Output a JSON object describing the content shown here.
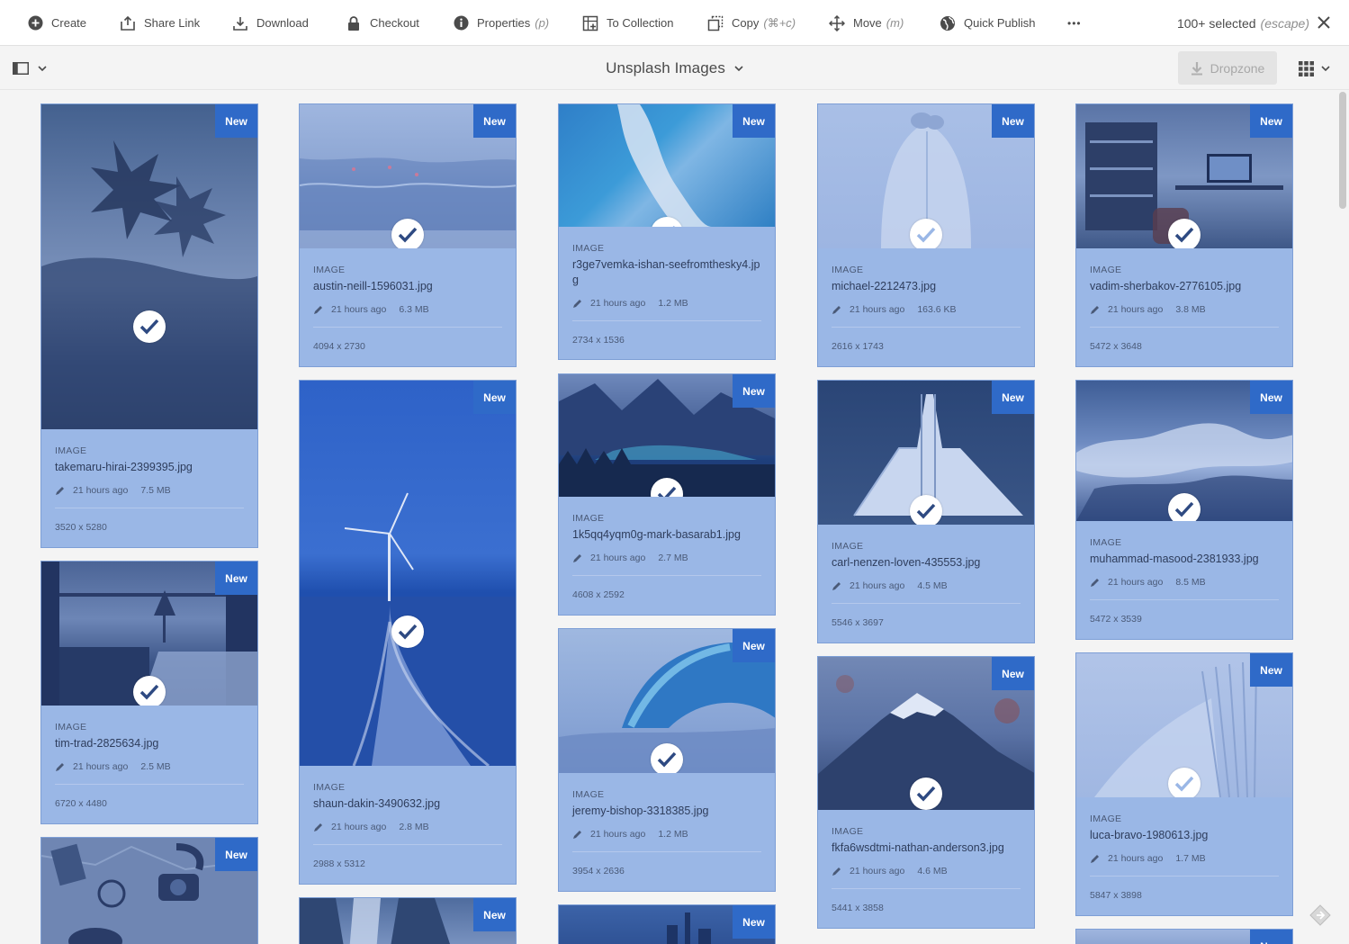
{
  "toolbar": {
    "create": "Create",
    "share_link": "Share Link",
    "download": "Download",
    "checkout": "Checkout",
    "properties": "Properties",
    "properties_hint": "(p)",
    "to_collection": "To Collection",
    "copy": "Copy",
    "copy_hint": "(⌘+c)",
    "move": "Move",
    "move_hint": "(m)",
    "quick_publish": "Quick Publish",
    "more": "•••",
    "selected": "100+ selected",
    "selected_hint": "(escape)"
  },
  "titlebar": {
    "title": "Unsplash Images",
    "dropzone": "Dropzone"
  },
  "cards": [
    {
      "badge": "New",
      "type": "IMAGE",
      "name": "takemaru-hirai-2399395.jpg",
      "time": "21 hours ago",
      "size": "7.5 MB",
      "dims": "3520 x 5280"
    },
    {
      "badge": "New",
      "type": "IMAGE",
      "name": "tim-trad-2825634.jpg",
      "time": "21 hours ago",
      "size": "2.5 MB",
      "dims": "6720 x 4480"
    },
    {
      "badge": "New"
    },
    {
      "badge": "New",
      "type": "IMAGE",
      "name": "austin-neill-1596031.jpg",
      "time": "21 hours ago",
      "size": "6.3 MB",
      "dims": "4094 x 2730"
    },
    {
      "badge": "New",
      "type": "IMAGE",
      "name": "shaun-dakin-3490632.jpg",
      "time": "21 hours ago",
      "size": "2.8 MB",
      "dims": "2988 x 5312"
    },
    {
      "badge": "New"
    },
    {
      "badge": "New",
      "type": "IMAGE",
      "name": "r3ge7vemka-ishan-seefromthesky4.jpg",
      "time": "21 hours ago",
      "size": "1.2 MB",
      "dims": "2734 x 1536"
    },
    {
      "badge": "New",
      "type": "IMAGE",
      "name": "1k5qq4yqm0g-mark-basarab1.jpg",
      "time": "21 hours ago",
      "size": "2.7 MB",
      "dims": "4608 x 2592"
    },
    {
      "badge": "New",
      "type": "IMAGE",
      "name": "jeremy-bishop-3318385.jpg",
      "time": "21 hours ago",
      "size": "1.2 MB",
      "dims": "3954 x 2636"
    },
    {
      "badge": "New"
    },
    {
      "badge": "New",
      "type": "IMAGE",
      "name": "michael-2212473.jpg",
      "time": "21 hours ago",
      "size": "163.6 KB",
      "dims": "2616 x 1743"
    },
    {
      "badge": "New",
      "type": "IMAGE",
      "name": "carl-nenzen-loven-435553.jpg",
      "time": "21 hours ago",
      "size": "4.5 MB",
      "dims": "5546 x 3697"
    },
    {
      "badge": "New",
      "type": "IMAGE",
      "name": "fkfa6wsdtmi-nathan-anderson3.jpg",
      "time": "21 hours ago",
      "size": "4.6 MB",
      "dims": "5441 x 3858"
    },
    {
      "badge": "New",
      "type": "IMAGE",
      "name": "vadim-sherbakov-2776105.jpg",
      "time": "21 hours ago",
      "size": "3.8 MB",
      "dims": "5472 x 3648"
    },
    {
      "badge": "New",
      "type": "IMAGE",
      "name": "muhammad-masood-2381933.jpg",
      "time": "21 hours ago",
      "size": "8.5 MB",
      "dims": "5472 x 3539"
    },
    {
      "badge": "New",
      "type": "IMAGE",
      "name": "luca-bravo-1980613.jpg",
      "time": "21 hours ago",
      "size": "1.7 MB",
      "dims": "5847 x 3898"
    },
    {
      "badge": "New"
    }
  ]
}
